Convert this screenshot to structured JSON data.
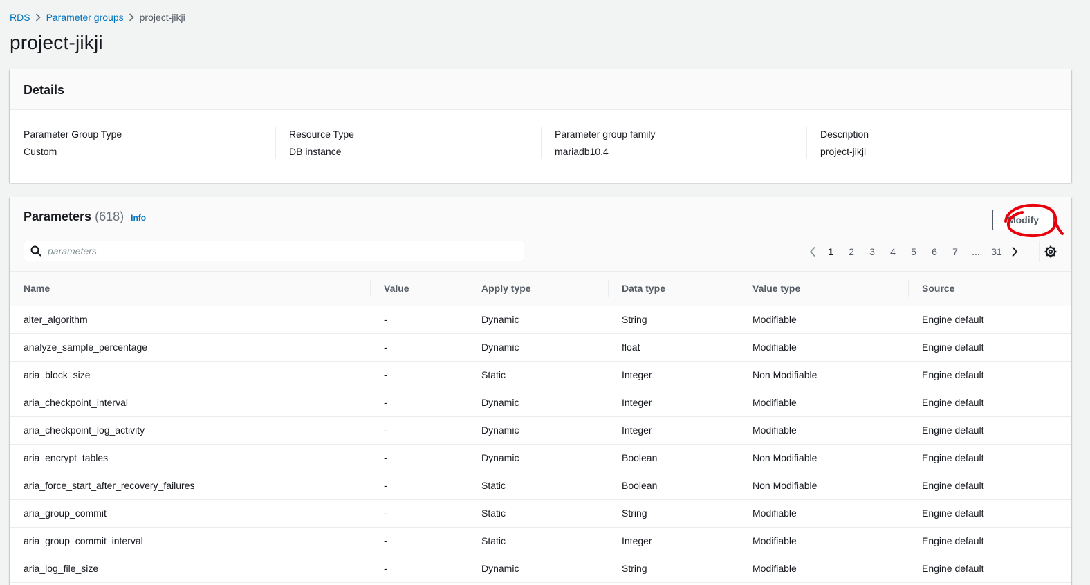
{
  "breadcrumb": {
    "items": [
      "RDS",
      "Parameter groups"
    ],
    "current": "project-jikji"
  },
  "page_title": "project-jikji",
  "details": {
    "title": "Details",
    "fields": [
      {
        "label": "Parameter Group Type",
        "value": "Custom"
      },
      {
        "label": "Resource Type",
        "value": "DB instance"
      },
      {
        "label": "Parameter group family",
        "value": "mariadb10.4"
      },
      {
        "label": "Description",
        "value": "project-jikji"
      }
    ]
  },
  "parameters": {
    "title": "Parameters",
    "count": "(618)",
    "info_label": "Info",
    "modify_label": "Modify",
    "search_placeholder": "parameters",
    "pagination": {
      "pages": [
        "1",
        "2",
        "3",
        "4",
        "5",
        "6",
        "7"
      ],
      "ellipsis": "...",
      "last": "31",
      "current": "1"
    },
    "columns": [
      "Name",
      "Value",
      "Apply type",
      "Data type",
      "Value type",
      "Source"
    ],
    "rows": [
      [
        "alter_algorithm",
        "-",
        "Dynamic",
        "String",
        "Modifiable",
        "Engine default"
      ],
      [
        "analyze_sample_percentage",
        "-",
        "Dynamic",
        "float",
        "Modifiable",
        "Engine default"
      ],
      [
        "aria_block_size",
        "-",
        "Static",
        "Integer",
        "Non Modifiable",
        "Engine default"
      ],
      [
        "aria_checkpoint_interval",
        "-",
        "Dynamic",
        "Integer",
        "Modifiable",
        "Engine default"
      ],
      [
        "aria_checkpoint_log_activity",
        "-",
        "Dynamic",
        "Integer",
        "Modifiable",
        "Engine default"
      ],
      [
        "aria_encrypt_tables",
        "-",
        "Dynamic",
        "Boolean",
        "Non Modifiable",
        "Engine default"
      ],
      [
        "aria_force_start_after_recovery_failures",
        "-",
        "Static",
        "Boolean",
        "Non Modifiable",
        "Engine default"
      ],
      [
        "aria_group_commit",
        "-",
        "Static",
        "String",
        "Modifiable",
        "Engine default"
      ],
      [
        "aria_group_commit_interval",
        "-",
        "Static",
        "Integer",
        "Modifiable",
        "Engine default"
      ],
      [
        "aria_log_file_size",
        "-",
        "Dynamic",
        "String",
        "Modifiable",
        "Engine default"
      ]
    ]
  },
  "colors": {
    "link": "#0073bb",
    "annotation": "#e8000b",
    "background": "#f2f3f3"
  },
  "icons": {
    "search": "search-icon",
    "prev": "chevron-left-icon",
    "next": "chevron-right-icon",
    "settings": "gear-icon",
    "separator": "chevron-right-icon"
  }
}
